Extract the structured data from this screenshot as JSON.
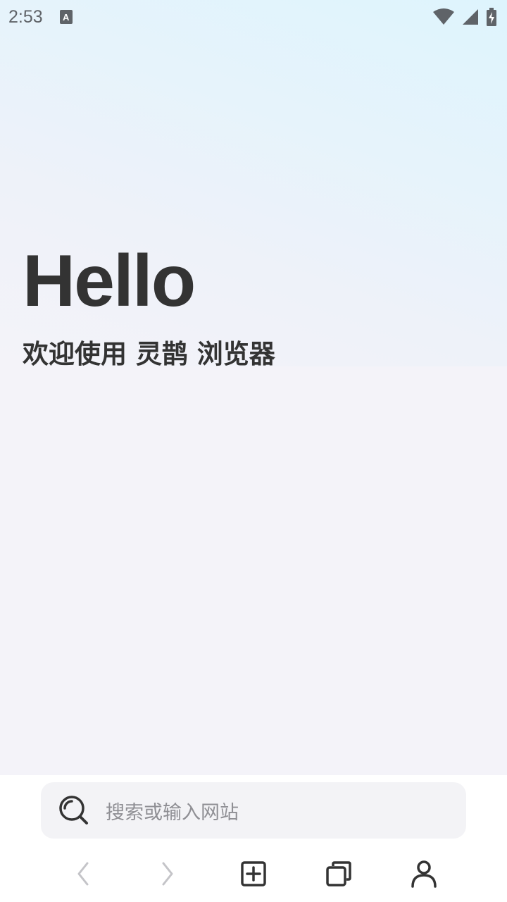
{
  "status_bar": {
    "time": "2:53",
    "notification_icon_letter": "A",
    "icons": [
      "wifi-icon",
      "signal-icon",
      "battery-icon"
    ]
  },
  "hero": {
    "greeting": "Hello",
    "welcome": "欢迎使用 灵鹊 浏览器"
  },
  "search": {
    "placeholder": "搜索或输入网站",
    "icon": "search-icon"
  },
  "nav": {
    "items": [
      {
        "icon": "back-arrow-icon",
        "enabled": false
      },
      {
        "icon": "forward-arrow-icon",
        "enabled": false
      },
      {
        "icon": "new-tab-icon",
        "enabled": true
      },
      {
        "icon": "tabs-icon",
        "enabled": true
      },
      {
        "icon": "profile-icon",
        "enabled": true
      }
    ]
  },
  "colors": {
    "text_dark": "#333333",
    "placeholder": "#8f8f94",
    "disabled_icon": "#c4c4c8",
    "gradient_top": "#def4fd",
    "page_bg": "#f4f3f9"
  }
}
